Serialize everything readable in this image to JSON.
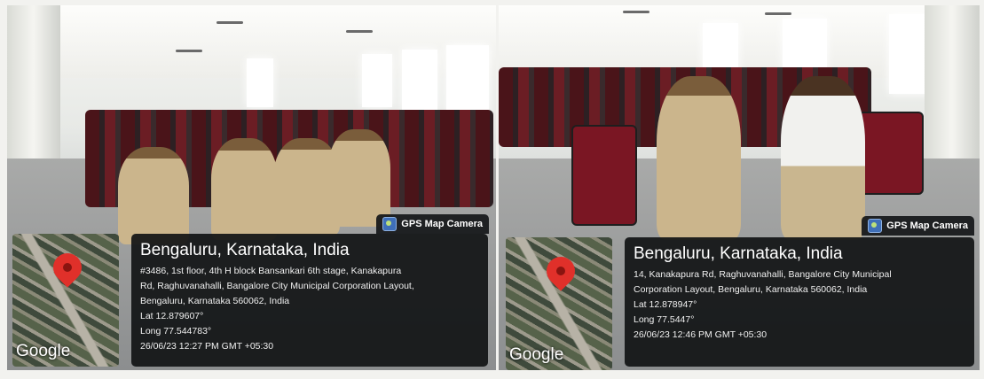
{
  "left_photo": {
    "badge": "GPS Map Camera",
    "map_logo": "Google",
    "city": "Bengaluru, Karnataka, India",
    "address_lines": [
      "#3486, 1st floor, 4th H block Bansankari 6th stage, Kanakapura",
      "Rd, Raghuvanahalli, Bangalore City Municipal Corporation Layout,",
      "Bengaluru, Karnataka 560062, India"
    ],
    "lat": "Lat 12.879607°",
    "long": "Long 77.544783°",
    "timestamp": "26/06/23 12:27 PM GMT +05:30"
  },
  "right_photo": {
    "badge": "GPS Map Camera",
    "map_logo": "Google",
    "city": "Bengaluru, Karnataka, India",
    "address_lines": [
      "14, Kanakapura Rd, Raghuvanahalli, Bangalore City Municipal",
      "Corporation Layout, Bengaluru, Karnataka 560062, India"
    ],
    "lat": "Lat 12.878947°",
    "long": "Long 77.5447°",
    "timestamp": "26/06/23 12:46 PM GMT +05:30"
  },
  "colors": {
    "overlay": "#141618",
    "pin": "#e0302a",
    "chairs": "#7a1623",
    "uniform": "#cbb58c"
  },
  "icons": [
    "camera-icon",
    "location-pin-icon"
  ]
}
